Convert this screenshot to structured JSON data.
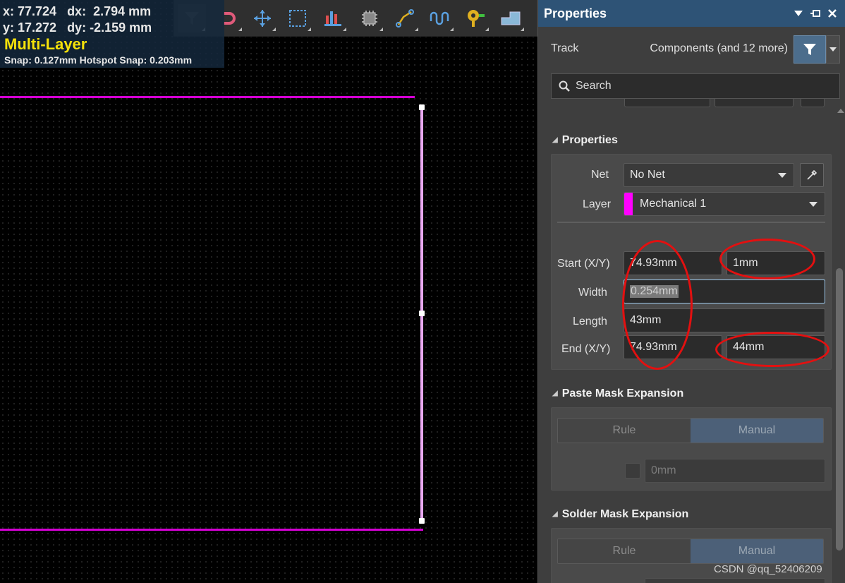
{
  "hud": {
    "x_line": "x: 77.724   dx:  2.794 mm",
    "y_line": "y: 17.272   dy: -2.159 mm",
    "layer": "Multi-Layer",
    "snap": "Snap: 0.127mm Hotspot Snap: 0.203mm"
  },
  "toolbar": {
    "icons": [
      "filter-icon",
      "magnet-icon",
      "move-icon",
      "select-rect-icon",
      "bar-chart-icon",
      "component-icon",
      "route-icon",
      "tune-length-icon",
      "pad-icon",
      "polygon-icon"
    ]
  },
  "colors": {
    "track": "#d400d4",
    "layer_swatch": "#ff00ff",
    "panel_header": "#2e5376",
    "annotation": "#e31010",
    "hud_layer_text": "#f5e10a"
  },
  "panel": {
    "title": "Properties",
    "object_kind": "Track",
    "filter_summary": "Components (and 12 more)",
    "search_placeholder": "Search",
    "properties_section": {
      "title": "Properties",
      "net_label": "Net",
      "net_value": "No Net",
      "layer_label": "Layer",
      "layer_value": "Mechanical 1",
      "start_label": "Start (X/Y)",
      "start_x": "74.93mm",
      "start_y": "1mm",
      "width_label": "Width",
      "width_value": "0.254mm",
      "length_label": "Length",
      "length_value": "43mm",
      "end_label": "End (X/Y)",
      "end_x": "74.93mm",
      "end_y": "44mm"
    },
    "paste_mask": {
      "title": "Paste Mask Expansion",
      "rule": "Rule",
      "manual": "Manual",
      "value": "0mm"
    },
    "solder_mask": {
      "title": "Solder Mask Expansion",
      "rule": "Rule",
      "manual": "Manual"
    }
  },
  "watermark": "CSDN @qq_52406209"
}
